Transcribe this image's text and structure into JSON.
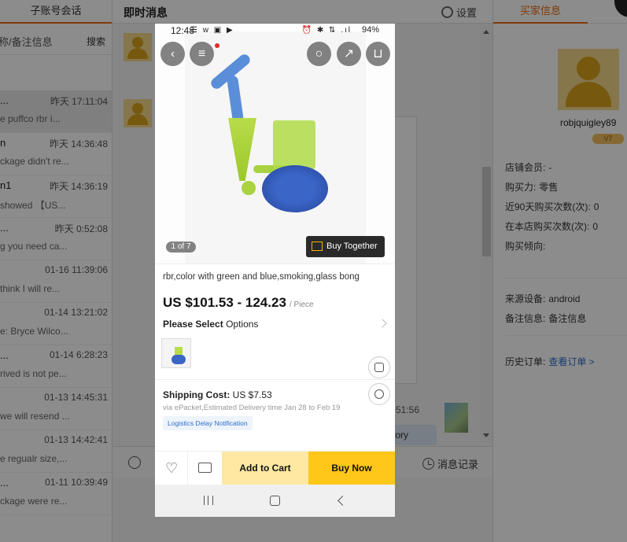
{
  "left": {
    "tab": "子账号会话",
    "search_placeholder": "称/备注信息",
    "search_button": "搜索",
    "conversations": [
      {
        "name": "...",
        "time": "昨天 17:11:04",
        "preview": "e puffco rbr i...",
        "active": true
      },
      {
        "name": "n",
        "time": "昨天 14:36:48",
        "preview": "ckage didn't re..."
      },
      {
        "name": "n1",
        "time": "昨天 14:36:19",
        "preview": "showed 【US..."
      },
      {
        "name": "...",
        "time": "昨天 0:52:08",
        "preview": "g you need ca..."
      },
      {
        "name": "",
        "time": "01-16 11:39:06",
        "preview": "think I will re..."
      },
      {
        "name": "",
        "time": "01-14 13:21:02",
        "preview": "e: Bryce Wilco..."
      },
      {
        "name": "...",
        "time": "01-14 6:28:23",
        "preview": "rived is not pe..."
      },
      {
        "name": "",
        "time": "01-13 14:45:31",
        "preview": "we will resend ..."
      },
      {
        "name": "",
        "time": "01-13 14:42:41",
        "preview": "e regualr size,..."
      },
      {
        "name": "...",
        "time": "01-11 10:39:49",
        "preview": "ckage were re..."
      }
    ]
  },
  "middle": {
    "title": "即时消息",
    "settings": "设置",
    "time": "51:56",
    "pill_text": "tory",
    "history": "消息记录"
  },
  "right": {
    "tab": "买家信息",
    "username": "robjquigley89",
    "vip": "V7",
    "shop_member_label": "店铺会员:",
    "shop_member_value": "-",
    "purchasing_power_label": "购买力:",
    "purchasing_power_value": "零售",
    "recent90_label": "近90天购买次数(次):",
    "recent90_value": "0",
    "store_buys_label": "在本店购买次数(次):",
    "store_buys_value": "0",
    "tendency_label": "购买倾向:",
    "device_label": "来源设备:",
    "device_value": "android",
    "note_label": "备注信息:",
    "note_value": "备注信息",
    "orders_label": "历史订单:",
    "orders_link": "查看订单 >"
  },
  "phone": {
    "status_time": "12:48",
    "status_battery": "94%",
    "status_icons_left": "☰ w ▣ ▶",
    "status_icons_right": "⏰ ✱ ⇅ .ıl",
    "image_counter": "1 of 7",
    "buy_together": "Buy Together >",
    "title": "rbr,color with green and blue,smoking,glass bong",
    "price": "US $101.53 - 124.23",
    "price_unit": "/ Piece",
    "select_label": "Please Select",
    "select_value": "Options",
    "shipping_label": "Shipping Cost:",
    "shipping_value": "US $7.53",
    "shipping_sub": "via ePacket,Estimated Delivery time Jan 28 to Feb 19",
    "logistics_tag": "Logistics Delay Notification",
    "add_to_cart": "Add to Cart",
    "buy_now": "Buy Now",
    "colors": {
      "cart_bg": "#ffe8a1",
      "buy_bg": "#ffc71a",
      "accent": "#e86a0e"
    }
  }
}
